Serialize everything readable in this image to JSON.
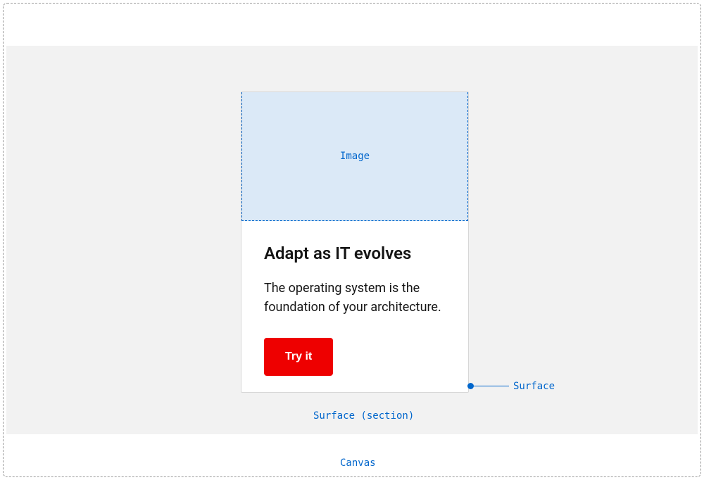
{
  "annotations": {
    "image": "Image",
    "surface": "Surface",
    "section": "Surface (section)",
    "canvas": "Canvas"
  },
  "card": {
    "title": "Adapt as IT evolves",
    "description": "The operating system is the foundation of your architecture.",
    "button": "Try it"
  }
}
